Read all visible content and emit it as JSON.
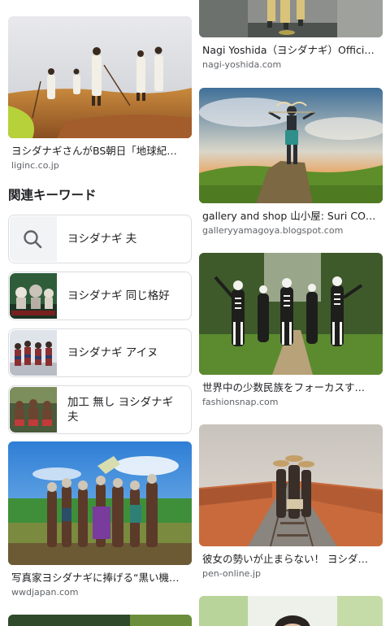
{
  "left_column": {
    "top_result": {
      "title": "ヨシダナギさんがBS朝日「地球紀…",
      "source": "liginc.co.jp"
    },
    "related_heading": "関連キーワード",
    "keywords": [
      {
        "label": "ヨシダナギ 夫",
        "icon": "search-icon"
      },
      {
        "label": "ヨシダナギ 同じ格好",
        "icon": "thumbnail"
      },
      {
        "label": "ヨシダナギ アイヌ",
        "icon": "thumbnail"
      },
      {
        "label": "加工 無し ヨシダナギ 夫",
        "icon": "thumbnail"
      }
    ],
    "bottom_result": {
      "title": "写真家ヨシダナギに捧げる“黒い機…",
      "source": "wwdjapan.com"
    }
  },
  "right_column": {
    "results": [
      {
        "title": "Nagi Yoshida（ヨシダナギ）Offici…",
        "source": "nagi-yoshida.com"
      },
      {
        "title": "gallery and shop 山小屋: Suri COLL…",
        "source": "galleryyamagoya.blogspot.com"
      },
      {
        "title": "世界中の少数民族をフォーカスす…",
        "source": "fashionsnap.com"
      },
      {
        "title": "彼女の勢いが止まらない！ ヨシダ…",
        "source": "pen-online.jp"
      }
    ]
  },
  "colors": {
    "title_text": "#202124",
    "source_text": "#5f6368",
    "card_border": "#dadce0",
    "search_icon": "#5f6368"
  }
}
